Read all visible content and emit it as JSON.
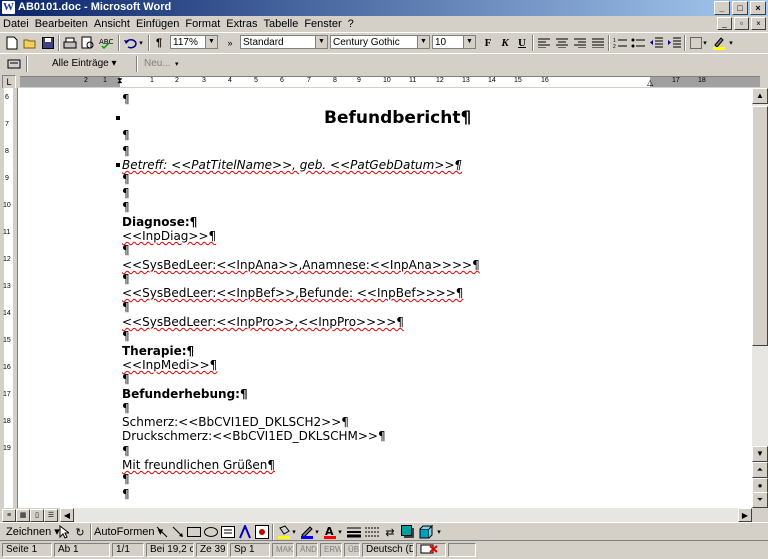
{
  "window": {
    "title": "AB0101.doc - Microsoft Word",
    "app_icon": "W"
  },
  "menu": [
    "Datei",
    "Bearbeiten",
    "Ansicht",
    "Einfügen",
    "Format",
    "Extras",
    "Tabelle",
    "Fenster",
    "?"
  ],
  "toolbar": {
    "zoom": "117%",
    "style": "Standard",
    "font": "Century Gothic",
    "size": "10",
    "bold": "F",
    "italic": "K",
    "underline": "U"
  },
  "toolbar2": {
    "entries": "Alle Einträge ▾",
    "new": "Neu..."
  },
  "ruler": {
    "ticks": [
      "2",
      "1",
      "1",
      "2",
      "3",
      "4",
      "5",
      "6",
      "7",
      "8",
      "9",
      "10",
      "11",
      "12",
      "13",
      "14",
      "15",
      "16",
      "17",
      "18"
    ]
  },
  "vruler": {
    "nums": [
      "6",
      "7",
      "8",
      "9",
      "10",
      "11",
      "12",
      "13",
      "14",
      "15",
      "16",
      "17",
      "18",
      "19"
    ]
  },
  "document": {
    "heading": "Befundbericht¶",
    "lines": [
      {
        "text": "¶"
      },
      {
        "text": "¶"
      },
      {
        "text": "¶"
      },
      {
        "text": "Betreff: <<PatTitelName>>, geb. <<PatGebDatum>>¶"
      },
      {
        "text": "¶"
      },
      {
        "text": "¶"
      },
      {
        "text": "¶"
      },
      {
        "text": "Diagnose:¶"
      },
      {
        "text": "<<InpDiag>>¶"
      },
      {
        "text": "¶"
      },
      {
        "text": "<<SysBedLeer:<<InpAna>>,Anamnese:<<InpAna>>>>¶"
      },
      {
        "text": "¶"
      },
      {
        "text": "<<SysBedLeer:<<InpBef>>,Befunde: <<InpBef>>>>¶"
      },
      {
        "text": "¶"
      },
      {
        "text": "<<SysBedLeer:<<InpPro>>,<<InpPro>>>>¶"
      },
      {
        "text": "¶"
      },
      {
        "text": "Therapie:¶"
      },
      {
        "text": "<<InpMedi>>¶"
      },
      {
        "text": "¶"
      },
      {
        "text": "Befunderhebung:¶"
      },
      {
        "text": "¶"
      },
      {
        "text": "Schmerz:<<BbCVI1ED_DKLSCH2>>¶"
      },
      {
        "text": "Druckschmerz:<<BbCVI1ED_DKLSCHM>>¶"
      },
      {
        "text": "¶"
      },
      {
        "text": "Mit freundlichen Grüßen¶"
      },
      {
        "text": "¶"
      },
      {
        "text": "¶"
      }
    ]
  },
  "drawing": {
    "draw": "Zeichnen ▾",
    "autoshapes": "AutoFormen ▾"
  },
  "status": {
    "page": "Seite  1",
    "section": "Ab  1",
    "pages": "1/1",
    "pos": "Bei 19,2 cm",
    "line": "Ze  39",
    "col": "Sp  1",
    "mak": "MAK",
    "and": "ÄND",
    "erw": "ERW",
    "ub": "ÜB",
    "lang": "Deutsch (De"
  }
}
